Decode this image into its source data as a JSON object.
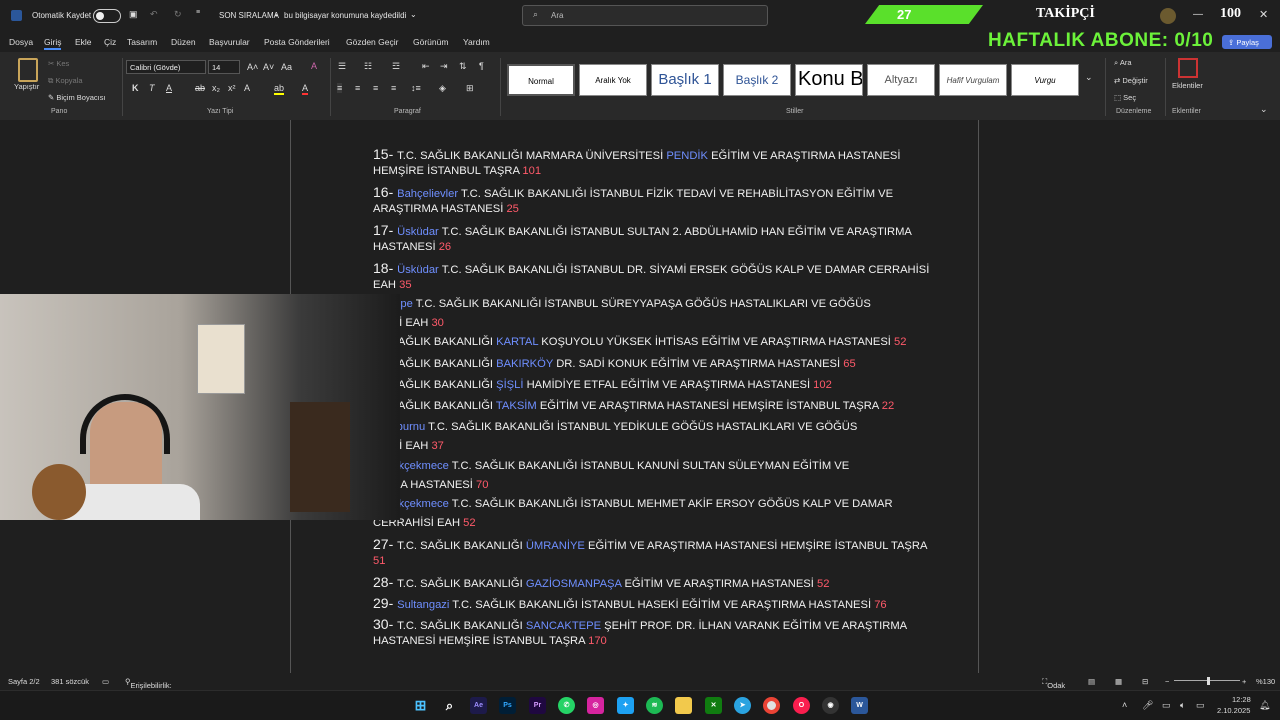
{
  "titlebar": {
    "autosave_label": "Otomatik Kaydet",
    "doc_title": "SON SIRALAMA",
    "doc_status": "bu bilgisayar konumuna kaydedildi",
    "search_placeholder": "Ara"
  },
  "overlay": {
    "green_count": "27",
    "followers_label": "TAKİPÇİ",
    "followers_count": "100",
    "sub_goal": "HAFTALIK ABONE: 0/10",
    "share_label": "Paylaş"
  },
  "menu": [
    "Dosya",
    "Giriş",
    "Ekle",
    "Çiz",
    "Tasarım",
    "Düzen",
    "Başvurular",
    "Posta Gönderileri",
    "Gözden Geçir",
    "Görünüm",
    "Yardım"
  ],
  "ribbon": {
    "paste_label": "Yapıştır",
    "cut_label": "Kes",
    "copy_label": "Kopyala",
    "format_painter_label": "Biçim Boyacısı",
    "font_name": "Calibri (Gövde)",
    "font_size": "14",
    "groups": {
      "clipboard": "Pano",
      "font": "Yazı Tipi",
      "paragraph": "Paragraf",
      "styles": "Stiller",
      "editing": "Düzenleme",
      "addins": "Eklentiler"
    },
    "styles": [
      "Normal",
      "Aralık Yok",
      "Başlık 1",
      "Başlık 2",
      "Konu Başlığı",
      "Altyazı",
      "Hafif Vurgulam",
      "Vurgu"
    ],
    "find_label": "Ara",
    "replace_label": "Değiştir",
    "select_label": "Seç",
    "addins_label": "Eklentiler"
  },
  "document": {
    "lines": [
      {
        "num": "15-",
        "parts": [
          [
            "T.C. SAĞLIK BAKANLIĞI MARMARA ÜNİVERSİTESİ ",
            "t"
          ],
          [
            "PENDİK",
            "b"
          ],
          [
            " EĞİTİM VE ARAŞTIRMA HASTANESİ",
            "t"
          ]
        ]
      },
      {
        "num": "",
        "parts": [
          [
            "HEMŞİRE İSTANBUL TAŞRA ",
            "t"
          ],
          [
            "101",
            "r"
          ]
        ]
      },
      {
        "num": "16-",
        "parts": [
          [
            "Bahçelievler",
            "b"
          ],
          [
            " T.C. SAĞLIK BAKANLIĞI İSTANBUL FİZİK TEDAVİ VE REHABİLİTASYON EĞİTİM VE",
            "t"
          ]
        ]
      },
      {
        "num": "",
        "parts": [
          [
            "ARAŞTIRMA HASTANESİ ",
            "t"
          ],
          [
            "25",
            "r"
          ]
        ]
      },
      {
        "num": "17-",
        "parts": [
          [
            "Üsküdar",
            "b"
          ],
          [
            " T.C. SAĞLIK BAKANLIĞI İSTANBUL SULTAN 2. ABDÜLHAMİD HAN EĞİTİM VE ARAŞTIRMA",
            "t"
          ]
        ]
      },
      {
        "num": "",
        "parts": [
          [
            "HASTANESİ ",
            "t"
          ],
          [
            "26",
            "r"
          ]
        ]
      },
      {
        "num": "18-",
        "parts": [
          [
            "Üsküdar",
            "b"
          ],
          [
            " T.C. SAĞLIK BAKANLIĞI İSTANBUL DR. SİYAMİ ERSEK GÖĞÜS KALP VE DAMAR CERRAHİSİ",
            "t"
          ]
        ]
      },
      {
        "num": "",
        "parts": [
          [
            "EAH ",
            "t"
          ],
          [
            "35",
            "r"
          ]
        ]
      },
      {
        "num": "",
        "parts": [
          [
            "Maltepe",
            "b"
          ],
          [
            " T.C. SAĞLIK BAKANLIĞI İSTANBUL SÜREYYAPAŞA GÖĞÜS HASTALIKLARI VE GÖĞÜS",
            "t"
          ]
        ]
      },
      {
        "num": "",
        "parts": [
          [
            "AHİSİ EAH ",
            "t"
          ],
          [
            "30",
            "r"
          ]
        ]
      },
      {
        "num": "",
        "parts": [
          [
            ".C. SAĞLIK BAKANLIĞI ",
            "t"
          ],
          [
            "KARTAL",
            "b"
          ],
          [
            " KOŞUYOLU YÜKSEK İHTİSAS EĞİTİM VE ARAŞTIRMA HASTANESİ ",
            "t"
          ],
          [
            "52",
            "r"
          ]
        ]
      },
      {
        "num": "",
        "parts": [
          [
            ".C. SAĞLIK BAKANLIĞI ",
            "t"
          ],
          [
            "BAKIRKÖY",
            "b"
          ],
          [
            " DR. SADİ KONUK EĞİTİM VE ARAŞTIRMA HASTANESİ ",
            "t"
          ],
          [
            "65",
            "r"
          ]
        ]
      },
      {
        "num": "",
        "parts": [
          [
            ".C. SAĞLIK BAKANLIĞI ",
            "t"
          ],
          [
            "ŞİŞLİ",
            "b"
          ],
          [
            " HAMİDİYE ETFAL EĞİTİM VE ARAŞTIRMA HASTANESİ ",
            "t"
          ],
          [
            "102",
            "r"
          ]
        ]
      },
      {
        "num": "",
        "parts": [
          [
            ".C. SAĞLIK BAKANLIĞI ",
            "t"
          ],
          [
            "TAKSİM",
            "b"
          ],
          [
            " EĞİTİM VE ARAŞTIRMA HASTANESİ HEMŞİRE İSTANBUL TAŞRA ",
            "t"
          ],
          [
            "22",
            "r"
          ]
        ]
      },
      {
        "num": "",
        "parts": [
          [
            "eytinburnu",
            "b"
          ],
          [
            " T.C. SAĞLIK BAKANLIĞI İSTANBUL YEDİKULE GÖĞÜS HASTALIKLARI VE GÖĞÜS",
            "t"
          ]
        ]
      },
      {
        "num": "",
        "parts": [
          [
            "AHİSİ EAH ",
            "t"
          ],
          [
            "37",
            "r"
          ]
        ]
      },
      {
        "num": "",
        "parts": [
          [
            "Küçükçekmece",
            "b"
          ],
          [
            " T.C. SAĞLIK BAKANLIĞI İSTANBUL KANUNİ SULTAN SÜLEYMAN EĞİTİM VE",
            "t"
          ]
        ]
      },
      {
        "num": "",
        "parts": [
          [
            "TIRMA HASTANESİ ",
            "t"
          ],
          [
            "70",
            "r"
          ]
        ]
      },
      {
        "num": "",
        "parts": [
          [
            "Küçükçekmece",
            "b"
          ],
          [
            " T.C. SAĞLIK BAKANLIĞI İSTANBUL MEHMET AKİF ERSOY GÖĞÜS KALP VE DAMAR",
            "t"
          ]
        ]
      },
      {
        "num": "",
        "parts": [
          [
            "CERRAHİSİ EAH ",
            "t"
          ],
          [
            "52",
            "r"
          ]
        ]
      },
      {
        "num": "27-",
        "parts": [
          [
            "T.C. SAĞLIK BAKANLIĞI ",
            "t"
          ],
          [
            "ÜMRANİYE",
            "b"
          ],
          [
            " EĞİTİM VE ARAŞTIRMA HASTANESİ HEMŞİRE İSTANBUL TAŞRA",
            "t"
          ]
        ]
      },
      {
        "num": "",
        "parts": [
          [
            "51",
            "r"
          ]
        ]
      },
      {
        "num": "28-",
        "parts": [
          [
            "T.C. SAĞLIK BAKANLIĞI ",
            "t"
          ],
          [
            "GAZİOSMANPAŞA",
            "b"
          ],
          [
            " EĞİTİM VE ARAŞTIRMA HASTANESİ ",
            "t"
          ],
          [
            "52",
            "r"
          ]
        ]
      },
      {
        "num": "29-",
        "parts": [
          [
            "Sultangazi",
            "b"
          ],
          [
            " T.C. SAĞLIK BAKANLIĞI İSTANBUL HASEKİ EĞİTİM VE ARAŞTIRMA HASTANESİ ",
            "t"
          ],
          [
            "76",
            "r"
          ]
        ]
      },
      {
        "num": "30-",
        "parts": [
          [
            "T.C. SAĞLIK BAKANLIĞI ",
            "t"
          ],
          [
            "SANCAKTEPE",
            "b"
          ],
          [
            " ŞEHİT PROF. DR. İLHAN VARANK EĞİTİM VE ARAŞTIRMA",
            "t"
          ]
        ]
      },
      {
        "num": "",
        "parts": [
          [
            "HASTANESİ HEMŞİRE İSTANBUL TAŞRA ",
            "t"
          ],
          [
            "170",
            "r"
          ]
        ]
      }
    ]
  },
  "statusbar": {
    "page": "Sayfa 2/2",
    "words": "381 sözcük",
    "accessibility": "Erişilebilirlik: Her şey hazır",
    "focus": "Odak",
    "zoom": "%130"
  },
  "taskbar": {
    "time": "12:28",
    "date": "2.10.2025",
    "apps": [
      "windows-start",
      "search",
      "after-effects",
      "photoshop",
      "premiere",
      "whatsapp",
      "instagram",
      "twitter",
      "spotify",
      "file-explorer",
      "xbox",
      "telegram",
      "chrome",
      "opera-gx",
      "obs",
      "word"
    ]
  },
  "colors": {
    "accent_blue": "#6f8fff",
    "number_red": "#ff5a6a",
    "overlay_green": "#6cf23a"
  }
}
